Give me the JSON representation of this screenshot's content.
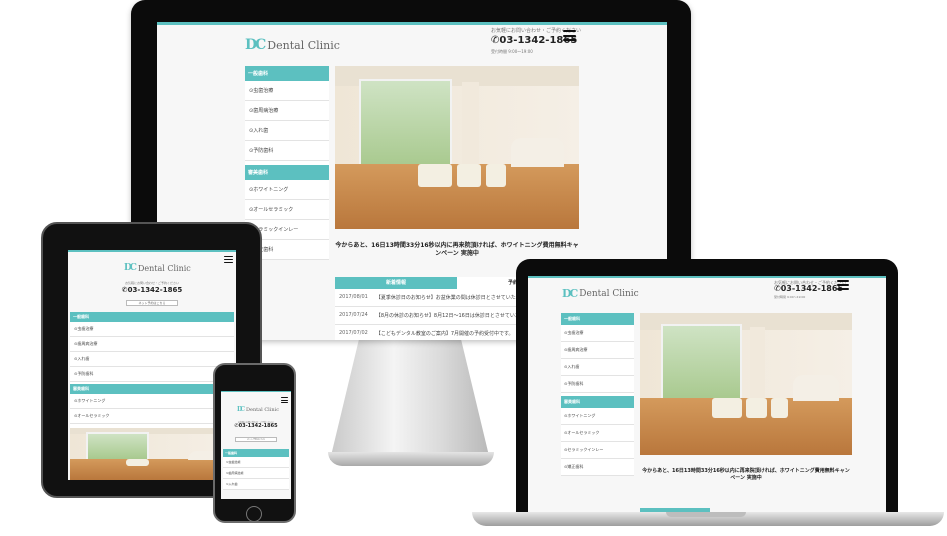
{
  "site": {
    "logo_mark": "DC",
    "logo_text": "Dental Clinic",
    "header_small": "お気軽にお問い合わせ・ご予約ください",
    "tel": "03-1342-1865",
    "tel_small": "受付時間 9:00〜19:00",
    "reserve_button": "ネット予約はこちら",
    "menu_icon": "hamburger-icon"
  },
  "sidebar": {
    "general_head": "一般歯科",
    "general_items": [
      "虫歯治療",
      "歯周病治療",
      "入れ歯",
      "予防歯科"
    ],
    "beauty_head": "審美歯科",
    "beauty_items": [
      "ホワイトニング",
      "オールセラミック",
      "セラミックインレー",
      "矯正歯科"
    ]
  },
  "banner": "今からあと、16日13時間33分16秒以内に再来院頂ければ、ホワイトニング費用無料キャンペーン 実施中",
  "news": {
    "tab_active": "新着情報",
    "tab_inactive": "予約情報",
    "items": [
      {
        "date": "2017/08/01",
        "text": "【夏季休診日のお知らせ】お盆休業の間は休診日とさせていただきます。ご不便をおかけしますが、ご了承ください。"
      },
      {
        "date": "2017/07/24",
        "text": "【8月の休診のお知らせ】8月12日〜16日は休診日とさせていただきます。よろしくお願いいたします。"
      },
      {
        "date": "2017/07/02",
        "text": "【こどもデンタル教室のご案内】7月開催の予約受付中です。"
      }
    ]
  },
  "colors": {
    "accent": "#5cc0c0",
    "device": "#0b0b0b"
  }
}
